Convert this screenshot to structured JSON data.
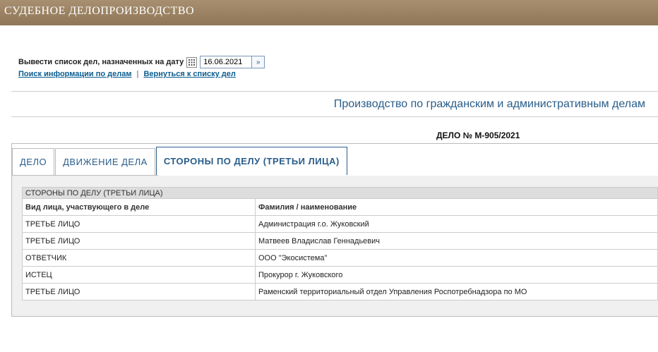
{
  "header": {
    "title": "СУДЕБНОЕ ДЕЛОПРОИЗВОДСТВО"
  },
  "date_filter": {
    "label": "Вывести список дел, назначенных на дату",
    "value": "16.06.2021"
  },
  "links": {
    "search": "Поиск информации по делам",
    "separator": "|",
    "back": "Вернуться к списку дел"
  },
  "court_title": "Производство по гражданским и административным делам",
  "case_number": "ДЕЛО № М-905/2021",
  "tabs": [
    {
      "label": "ДЕЛО"
    },
    {
      "label": "ДВИЖЕНИЕ ДЕЛА"
    },
    {
      "label": "СТОРОНЫ ПО ДЕЛУ (ТРЕТЬИ ЛИЦА)"
    }
  ],
  "parties_table": {
    "caption": "СТОРОНЫ ПО ДЕЛУ (ТРЕТЬИ ЛИЦА)",
    "columns": [
      "Вид лица, участвующего в деле",
      "Фамилия / наименование"
    ],
    "rows": [
      [
        "ТРЕТЬЕ ЛИЦО",
        "Администрация г.о. Жуковский"
      ],
      [
        "ТРЕТЬЕ ЛИЦО",
        "Матвеев Владислав Геннадьевич"
      ],
      [
        "ОТВЕТЧИК",
        "ООО \"Экосистема\""
      ],
      [
        "ИСТЕЦ",
        "Прокурор г. Жуковского"
      ],
      [
        "ТРЕТЬЕ ЛИЦО",
        "Раменский территориальный отдел Управления Роспотребнадзора по МО"
      ]
    ]
  }
}
